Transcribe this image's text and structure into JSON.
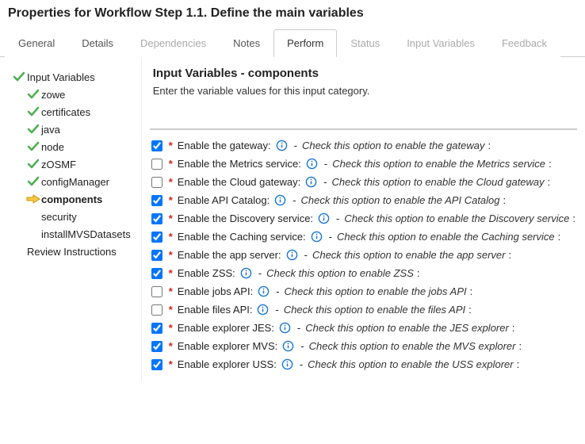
{
  "title": "Properties for Workflow Step 1.1. Define the main variables",
  "tabs": [
    {
      "label": "General",
      "state": "normal"
    },
    {
      "label": "Details",
      "state": "normal"
    },
    {
      "label": "Dependencies",
      "state": "disabled"
    },
    {
      "label": "Notes",
      "state": "normal"
    },
    {
      "label": "Perform",
      "state": "active"
    },
    {
      "label": "Status",
      "state": "disabled"
    },
    {
      "label": "Input Variables",
      "state": "disabled"
    },
    {
      "label": "Feedback",
      "state": "disabled"
    }
  ],
  "sidebar": [
    {
      "label": "Input Variables",
      "level": 0,
      "icon": "check",
      "current": false
    },
    {
      "label": "zowe",
      "level": 1,
      "icon": "check",
      "current": false
    },
    {
      "label": "certificates",
      "level": 1,
      "icon": "check",
      "current": false
    },
    {
      "label": "java",
      "level": 1,
      "icon": "check",
      "current": false
    },
    {
      "label": "node",
      "level": 1,
      "icon": "check",
      "current": false
    },
    {
      "label": "zOSMF",
      "level": 1,
      "icon": "check",
      "current": false
    },
    {
      "label": "configManager",
      "level": 1,
      "icon": "check",
      "current": false
    },
    {
      "label": "components",
      "level": 1,
      "icon": "arrow",
      "current": true
    },
    {
      "label": "security",
      "level": 1,
      "icon": "none",
      "current": false
    },
    {
      "label": "installMVSDatasets",
      "level": 1,
      "icon": "none",
      "current": false
    },
    {
      "label": "Review Instructions",
      "level": 0,
      "icon": "none",
      "current": false
    }
  ],
  "panel": {
    "title": "Input Variables - components",
    "subtitle": "Enter the variable values for this input category."
  },
  "options": [
    {
      "label": "Enable the gateway:",
      "hint": "Check this option to enable the gateway",
      "checked": true
    },
    {
      "label": "Enable the Metrics service:",
      "hint": "Check this option to enable the Metrics service",
      "checked": false
    },
    {
      "label": "Enable the Cloud gateway:",
      "hint": "Check this option to enable the Cloud gateway",
      "checked": false
    },
    {
      "label": "Enable API Catalog:",
      "hint": "Check this option to enable the API Catalog",
      "checked": true
    },
    {
      "label": "Enable the Discovery service:",
      "hint": "Check this option to enable the Discovery service",
      "checked": true
    },
    {
      "label": "Enable the Caching service:",
      "hint": "Check this option to enable the Caching service",
      "checked": true
    },
    {
      "label": "Enable the app server:",
      "hint": "Check this option to enable the app server",
      "checked": true
    },
    {
      "label": "Enable ZSS:",
      "hint": "Check this option to enable ZSS",
      "checked": true
    },
    {
      "label": "Enable jobs API:",
      "hint": "Check this option to enable the jobs API",
      "checked": false
    },
    {
      "label": "Enable files API:",
      "hint": "Check this option to enable the files API",
      "checked": false
    },
    {
      "label": "Enable explorer JES:",
      "hint": "Check this option to enable the JES explorer",
      "checked": true
    },
    {
      "label": "Enable explorer MVS:",
      "hint": "Check this option to enable the MVS explorer",
      "checked": true
    },
    {
      "label": "Enable explorer USS:",
      "hint": "Check this option to enable the USS explorer",
      "checked": true
    }
  ],
  "glyphs": {
    "required": "*",
    "sep": "-",
    "colonTail": ":"
  }
}
